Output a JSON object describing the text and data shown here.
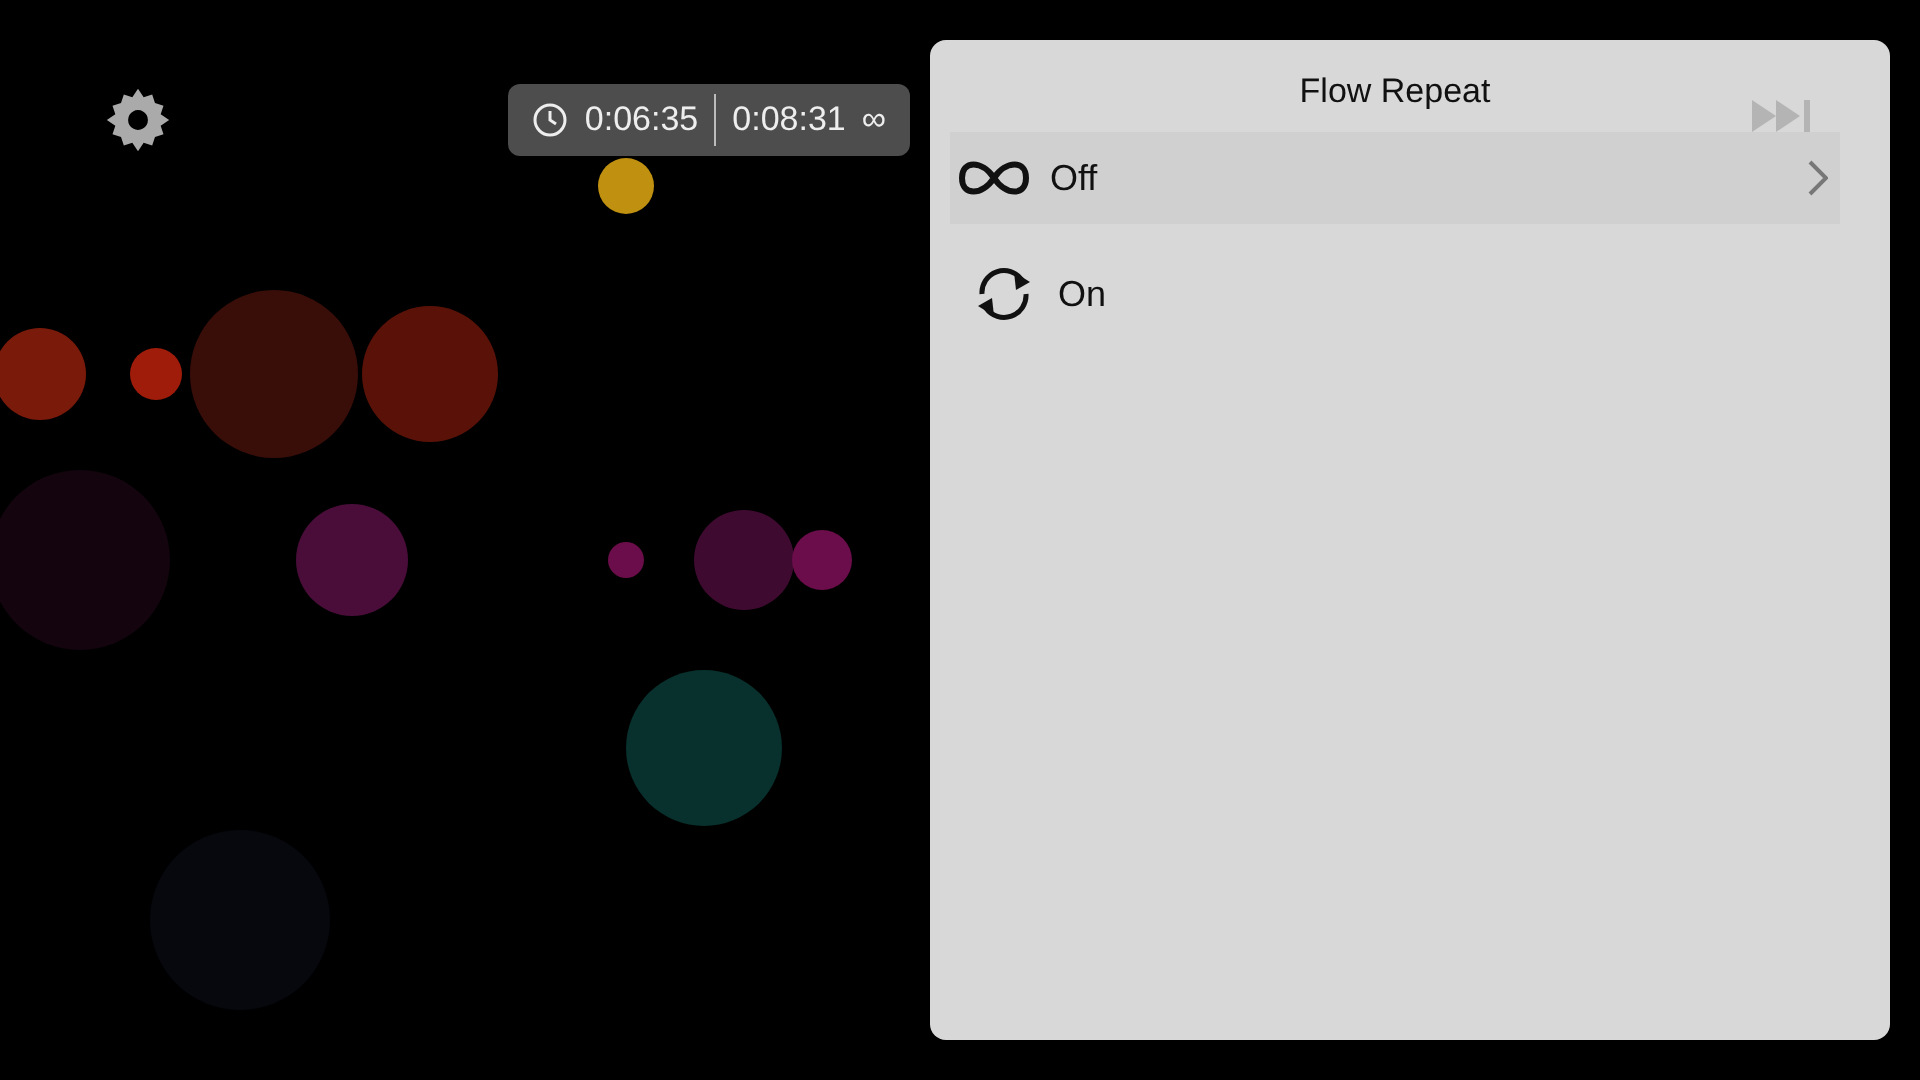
{
  "player": {
    "elapsed": "0:06:35",
    "duration": "0:08:31",
    "loop_symbol": "∞"
  },
  "panel": {
    "title": "Flow Repeat",
    "options": [
      {
        "label": "Off",
        "selected": true
      },
      {
        "label": "On",
        "selected": false
      }
    ]
  }
}
